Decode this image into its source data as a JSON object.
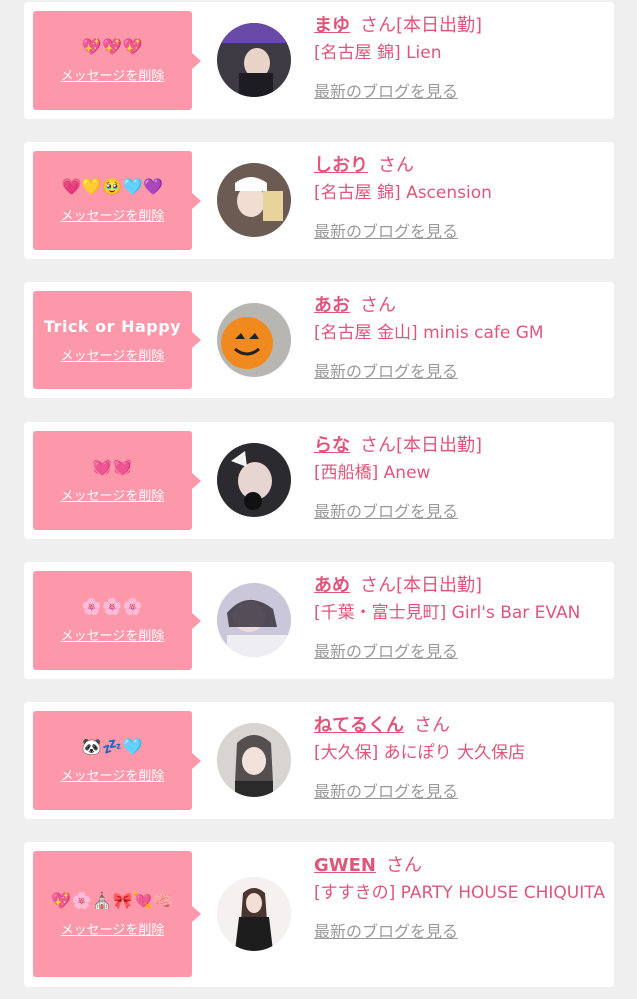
{
  "delete_label": "メッセージを削除",
  "blog_label": "最新のブログを見る",
  "honorific": "さん",
  "colors": {
    "accent": "#e0557a",
    "bubble": "#fd98aa",
    "link_gray": "#9a9a9a",
    "background": "#efefef"
  },
  "entries": [
    {
      "message": "💖💖💖",
      "name": "まゆ",
      "status": "[本日出勤]",
      "shop": "[名古屋 錦] Lien"
    },
    {
      "message": "💗💛🥹🩵💜",
      "name": "しおり",
      "status": "",
      "shop": "[名古屋 錦] Ascension"
    },
    {
      "message": "Trick or Happy",
      "name": "あお",
      "status": "",
      "shop": "[名古屋 金山] minis cafe GM"
    },
    {
      "message": "💓💓",
      "name": "らな",
      "status": "[本日出勤]",
      "shop": "[西船橋] Anew"
    },
    {
      "message": "🌸🌸🌸",
      "name": "あめ",
      "status": "[本日出勤]",
      "shop": "[千葉・富士見町] Girl's Bar EVAN"
    },
    {
      "message": "🐼💤🩵",
      "name": "ねてるくん",
      "status": "",
      "shop": "[大久保] あにぽり 大久保店"
    },
    {
      "message": "💖🌸⛪🎀💘🧠",
      "name": "GWEN",
      "status": "",
      "shop": "[すすきの] PARTY HOUSE CHIQUITA"
    }
  ]
}
